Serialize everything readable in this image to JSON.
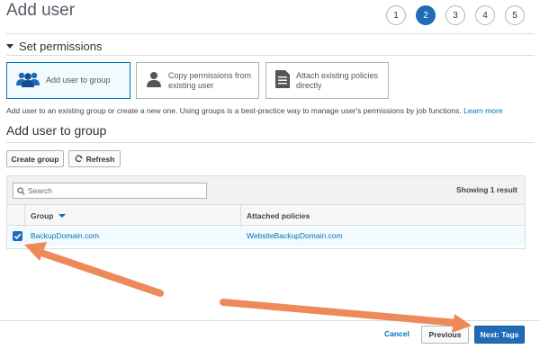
{
  "page": {
    "title": "Add user"
  },
  "steps": [
    "1",
    "2",
    "3",
    "4",
    "5"
  ],
  "active_step": "2",
  "set_permissions": {
    "heading": "Set permissions",
    "options": [
      {
        "label": "Add user to group",
        "icon": "users-group-icon",
        "selected": true
      },
      {
        "label": "Copy permissions from existing user",
        "icon": "user-icon",
        "selected": false
      },
      {
        "label": "Attach existing policies directly",
        "icon": "document-icon",
        "selected": false
      }
    ],
    "help_text": "Add user to an existing group or create a new one. Using groups is a best-practice way to manage user's permissions by job functions.",
    "learn_more": "Learn more"
  },
  "add_to_group": {
    "heading": "Add user to group",
    "create_group_label": "Create group",
    "refresh_label": "Refresh",
    "search_placeholder": "Search",
    "result_count": "Showing 1 result",
    "columns": {
      "group": "Group",
      "policies": "Attached policies"
    },
    "rows": [
      {
        "group": "BackupDomain.com",
        "policies": "WebsiteBackupDomain.com",
        "checked": true
      }
    ]
  },
  "footer": {
    "cancel_label": "Cancel",
    "previous_label": "Previous",
    "next_label": "Next: Tags"
  },
  "colors": {
    "primary": "#1e6cb6",
    "link": "#0073bb",
    "arrow": "#ee8a5a",
    "selected_bg": "#f1faff"
  }
}
